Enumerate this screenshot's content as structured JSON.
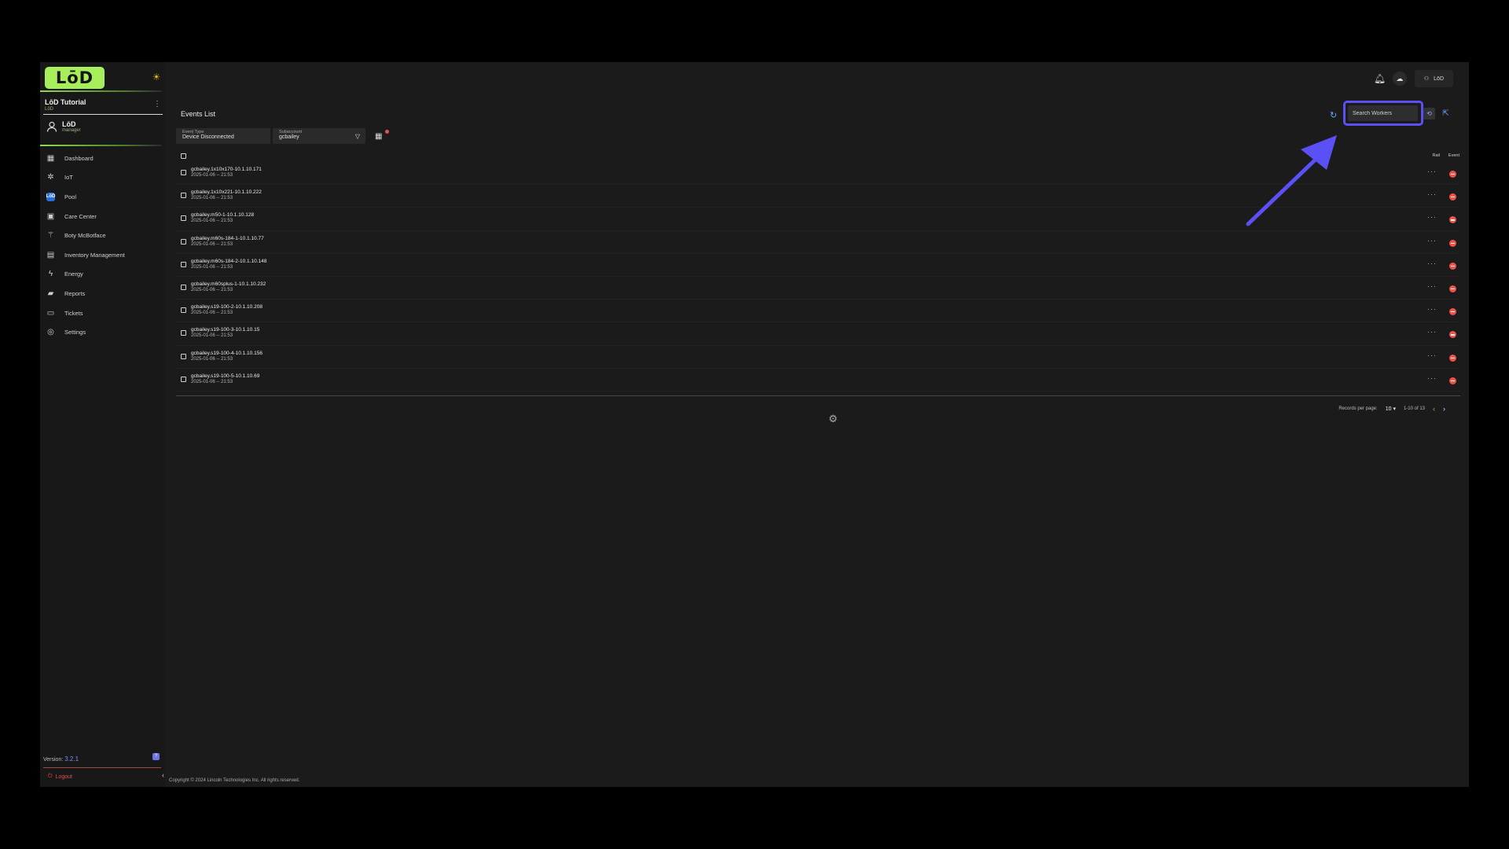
{
  "sidebar": {
    "logo_text": "LōD",
    "org_name": "LōD Tutorial",
    "org_sub": "LōD",
    "user_name": "LōD",
    "user_role": "manager",
    "items": [
      {
        "label": "Dashboard",
        "icon": "dashboard-icon",
        "glyph": "▦"
      },
      {
        "label": "IoT",
        "icon": "iot-icon",
        "glyph": "✲"
      },
      {
        "label": "Pool",
        "icon": "pool-icon",
        "glyph": "LōD"
      },
      {
        "label": "Care Center",
        "icon": "care-center-icon",
        "glyph": "▣"
      },
      {
        "label": "Boty McBotface",
        "icon": "bot-icon",
        "glyph": "⚚"
      },
      {
        "label": "Inventory Management",
        "icon": "inventory-icon",
        "glyph": "▤"
      },
      {
        "label": "Energy",
        "icon": "energy-icon",
        "glyph": "ϟ"
      },
      {
        "label": "Reports",
        "icon": "reports-icon",
        "glyph": "▰"
      },
      {
        "label": "Tickets",
        "icon": "tickets-icon",
        "glyph": "▭"
      },
      {
        "label": "Settings",
        "icon": "settings-icon",
        "glyph": "◎"
      }
    ],
    "version_label": "Version:",
    "version": "3.2.1",
    "logout": "Logout"
  },
  "header": {
    "account_label": "LōD"
  },
  "events": {
    "title": "Events List",
    "search_placeholder": "Search Workers",
    "filters": {
      "event_type_label": "Event Type",
      "event_type_value": "Device Disconnected",
      "subaccount_label": "Subaccount",
      "subaccount_value": "gcbailey"
    },
    "columns": {
      "rail": "Rail",
      "event": "Event"
    },
    "rows": [
      {
        "name": "gcbailey.1x10x170-10.1.10.171",
        "time": "2025-01-06 -- 21:53"
      },
      {
        "name": "gcbailey.1x10x221-10.1.10.222",
        "time": "2025-01-06 -- 21:53"
      },
      {
        "name": "gcbailey.m50-1-10.1.10.128",
        "time": "2025-01-06 -- 21:53"
      },
      {
        "name": "gcbailey.m60s-184-1-10.1.10.77",
        "time": "2025-01-06 -- 21:53"
      },
      {
        "name": "gcbailey.m60s-184-2-10.1.10.148",
        "time": "2025-01-06 -- 21:53"
      },
      {
        "name": "gcbailey.m60splus-1-10.1.10.232",
        "time": "2025-01-06 -- 21:53"
      },
      {
        "name": "gcbailey.s19-100-2-10.1.10.208",
        "time": "2025-01-06 -- 21:53"
      },
      {
        "name": "gcbailey.s19-100-3-10.1.10.15",
        "time": "2025-01-06 -- 21:53"
      },
      {
        "name": "gcbailey.s19-100-4-10.1.10.156",
        "time": "2025-01-06 -- 21:53"
      },
      {
        "name": "gcbailey.s19-100-5-10.1.10.69",
        "time": "2025-01-06 -- 21:53"
      }
    ],
    "pager": {
      "records_label": "Records per page:",
      "per_page": "10",
      "range": "1-10 of 13"
    }
  },
  "footer": {
    "copyright": "Copyright © 2024 Lincoln Technologies Inc. All rights reserved."
  },
  "colors": {
    "accent_green": "#a6ee5a",
    "highlight": "#5b50f5",
    "danger": "#f0524c",
    "link_blue": "#6aa2ff"
  }
}
